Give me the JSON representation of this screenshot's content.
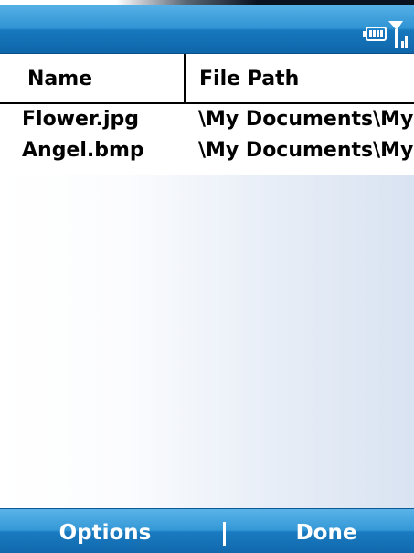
{
  "status_bar": {
    "icons": [
      "battery-icon",
      "signal-icon"
    ]
  },
  "list": {
    "columns": [
      "Name",
      "File Path"
    ],
    "rows": [
      {
        "name": "Flower.jpg",
        "path": "\\My Documents\\My"
      },
      {
        "name": "Angel.bmp",
        "path": "\\My Documents\\My"
      }
    ]
  },
  "softkeys": {
    "left_label": "Options",
    "right_label": "Done"
  },
  "colors": {
    "bar_blue": "#1778bd",
    "text": "#000000",
    "softkey_text": "#ffffff"
  }
}
